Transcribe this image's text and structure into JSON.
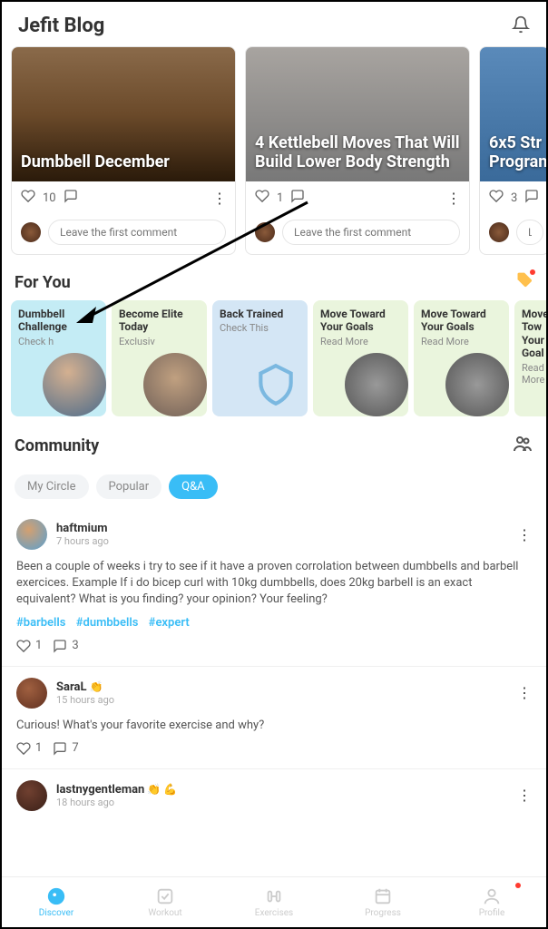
{
  "header": {
    "title": "Jefit Blog"
  },
  "blog": {
    "cards": [
      {
        "title": "Dumbbell December",
        "likes": "10",
        "comment_placeholder": "Leave the first comment"
      },
      {
        "title": "4 Kettlebell Moves That Will Build Lower Body Strength",
        "likes": "1",
        "comment_placeholder": "Leave the first comment"
      },
      {
        "title": "6x5 Str Progran",
        "likes": "3",
        "comment_placeholder": "Le"
      }
    ]
  },
  "foryou": {
    "title": "For You",
    "cards": [
      {
        "title": "Dumbbell Challenge",
        "sub": "Check h"
      },
      {
        "title": "Become Elite Today",
        "sub": "Exclusiv"
      },
      {
        "title": "Back Trained",
        "sub": "Check This"
      },
      {
        "title": "Move Toward Your Goals",
        "sub": "Read More"
      },
      {
        "title": "Move Toward Your Goals",
        "sub": "Read More"
      },
      {
        "title": "Move Tow Your Goal",
        "sub": "Read More"
      }
    ]
  },
  "community": {
    "title": "Community",
    "tabs": {
      "circle": "My Circle",
      "popular": "Popular",
      "qa": "Q&A"
    },
    "posts": [
      {
        "user": "haftmium",
        "time": "7 hours ago",
        "body": "Been a couple of weeks i try to see if it have a proven corrolation between dumbbells and barbell exercices. Example If i do bicep curl with 10kg dumbbells, does 20kg barbell is an exact equivalent? What is you finding? your opinion? Your feeling?",
        "tags": [
          "#barbells",
          "#dumbbells",
          "#expert"
        ],
        "likes": "1",
        "comments": "3",
        "badges": ""
      },
      {
        "user": "SaraL",
        "time": "15 hours ago",
        "body": "Curious! What's your favorite exercise and why?",
        "tags": [],
        "likes": "1",
        "comments": "7",
        "badges": "👏"
      },
      {
        "user": "lastnygentleman",
        "time": "18 hours ago",
        "body": "",
        "tags": [],
        "likes": "",
        "comments": "",
        "badges": "👏 💪"
      }
    ]
  },
  "nav": {
    "items": [
      {
        "label": "Discover"
      },
      {
        "label": "Workout"
      },
      {
        "label": "Exercises"
      },
      {
        "label": "Progress"
      },
      {
        "label": "Profile"
      }
    ]
  }
}
